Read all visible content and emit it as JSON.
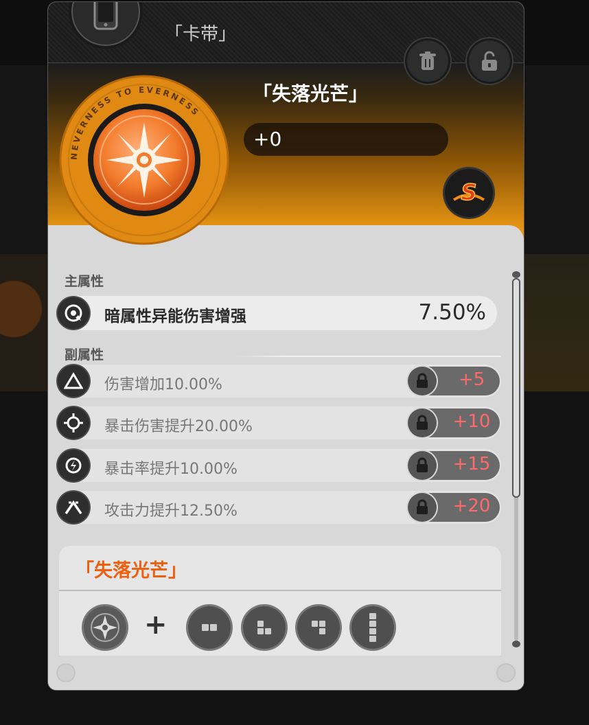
{
  "header": {
    "title": "「卡带」",
    "phone_icon": "phone-icon",
    "delete_icon": "trash-icon",
    "lock_icon": "unlocked-padlock-icon"
  },
  "disc": {
    "ring_text": "NEVERNESS TO EVERNESS",
    "name": "「失落光芒」",
    "level": "+0",
    "rank": "S",
    "colors": {
      "accent": "#e79512",
      "disc_core": "#f37b2c"
    }
  },
  "main_attr": {
    "label": "主属性",
    "name": "暗属性异能伤害增强",
    "value": "7.50%",
    "icon": "dark-element-icon"
  },
  "sub_attrs": {
    "label": "副属性",
    "rows": [
      {
        "name": "伤害增加10.00%",
        "upgrade": "+5",
        "icon": "triangle-icon"
      },
      {
        "name": "暴击伤害提升20.00%",
        "upgrade": "+10",
        "icon": "crosshair-icon"
      },
      {
        "name": "暴击率提升10.00%",
        "upgrade": "+15",
        "icon": "crit-rate-icon"
      },
      {
        "name": "攻击力提升12.50%",
        "upgrade": "+20",
        "icon": "attack-icon"
      }
    ]
  },
  "set_bonus": {
    "title": "「失落光芒」",
    "plus": "+",
    "slots": [
      "domino-2-icon",
      "domino-3-icon",
      "domino-3-alt-icon",
      "domino-4-icon"
    ]
  }
}
